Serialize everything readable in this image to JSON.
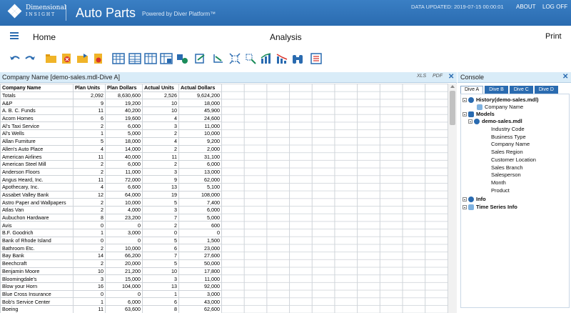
{
  "header": {
    "logo_line1": "Dimensional",
    "logo_line2": "INSIGHT",
    "app_title": "Auto Parts",
    "powered_by": "Powered by Diver Platform™",
    "data_updated": "DATA UPDATED: 2019-07-15 00:00:01",
    "about": "ABOUT",
    "logoff": "LOG OFF",
    "brand_color": "#2a6bb0"
  },
  "nav": {
    "home": "Home",
    "center_title": "Analysis",
    "print": "Print"
  },
  "toolbar": {
    "icons": [
      "undo-icon",
      "redo-icon",
      "open-folder-icon",
      "delete-icon",
      "save-folder-icon",
      "report-icon",
      "table-icon",
      "table-icon",
      "table-icon",
      "table-icon",
      "chart-icon",
      "export-icon",
      "shuffle-icon",
      "settings-icon",
      "bar-chart-icon",
      "line-chart-icon",
      "binoculars-icon",
      "list-icon"
    ]
  },
  "left_panel": {
    "title": "Company Name [demo-sales.mdl-Dive A]",
    "xls_label": "XLS",
    "pdf_label": "PDF",
    "columns": [
      "Company Name",
      "Plan Units",
      "Plan Dollars",
      "Actual Units",
      "Actual Dollars"
    ],
    "rows": [
      [
        "Totals",
        "2,092",
        "8,630,600",
        "2,526",
        "9,624,200"
      ],
      [
        "A&P",
        "9",
        "19,200",
        "10",
        "18,000"
      ],
      [
        "A. B. C. Funds",
        "11",
        "40,200",
        "10",
        "45,900"
      ],
      [
        "Acorn Homes",
        "6",
        "19,600",
        "4",
        "24,600"
      ],
      [
        "Al's Taxi Service",
        "2",
        "6,000",
        "3",
        "11,000"
      ],
      [
        "Al's Wells",
        "1",
        "5,000",
        "2",
        "10,000"
      ],
      [
        "Allan Furniture",
        "5",
        "18,000",
        "4",
        "9,200"
      ],
      [
        "Allen's Auto Place",
        "4",
        "14,000",
        "2",
        "2,000"
      ],
      [
        "American Airlines",
        "11",
        "40,000",
        "11",
        "31,100"
      ],
      [
        "American Steel Mill",
        "2",
        "6,000",
        "2",
        "6,000"
      ],
      [
        "Anderson Floors",
        "2",
        "11,000",
        "3",
        "13,000"
      ],
      [
        "Angus Heard, Inc.",
        "11",
        "72,000",
        "9",
        "62,000"
      ],
      [
        "Apothecary, Inc.",
        "4",
        "6,600",
        "13",
        "5,100"
      ],
      [
        "Assabet Valley Bank",
        "12",
        "64,000",
        "19",
        "108,000"
      ],
      [
        "Astro Paper and Wallpapers",
        "2",
        "10,000",
        "5",
        "7,400"
      ],
      [
        "Atlas Van",
        "2",
        "4,000",
        "3",
        "6,000"
      ],
      [
        "Aubuchon Hardware",
        "8",
        "23,200",
        "7",
        "5,000"
      ],
      [
        "Avis",
        "0",
        "0",
        "2",
        "600"
      ],
      [
        "B.F. Goodrich",
        "1",
        "3,000",
        "0",
        "0"
      ],
      [
        "Bank of Rhode Island",
        "0",
        "0",
        "5",
        "1,500"
      ],
      [
        "Bathroom Etc.",
        "2",
        "10,000",
        "6",
        "23,000"
      ],
      [
        "Bay Bank",
        "14",
        "66,200",
        "7",
        "27,600"
      ],
      [
        "Beechcraft",
        "2",
        "20,000",
        "5",
        "50,000"
      ],
      [
        "Benjamin Moore",
        "10",
        "21,200",
        "10",
        "17,800"
      ],
      [
        "Bloomingdale's",
        "3",
        "15,000",
        "3",
        "11,000"
      ],
      [
        "Blow your Horn",
        "16",
        "104,000",
        "13",
        "92,000"
      ],
      [
        "Blue Cross Insurance",
        "0",
        "0",
        "1",
        "3,000"
      ],
      [
        "Bob's Service Center",
        "1",
        "6,000",
        "6",
        "43,000"
      ],
      [
        "Boeing",
        "11",
        "63,600",
        "8",
        "62,600"
      ]
    ]
  },
  "console": {
    "title": "Console",
    "tabs": [
      "Dive A",
      "Dive B",
      "Dive C",
      "Dive D"
    ],
    "tree": {
      "history": "History(demo-sales.mdl)",
      "history_child": "Company Name",
      "models": "Models",
      "model_file": "demo-sales.mdl",
      "dimensions": [
        "Industry Code",
        "Business Type",
        "Company Name",
        "Sales Region",
        "Customer Location",
        "Sales Branch",
        "Salesperson",
        "Month",
        "Product"
      ],
      "info": "Info",
      "time_series": "Time Series Info"
    }
  }
}
